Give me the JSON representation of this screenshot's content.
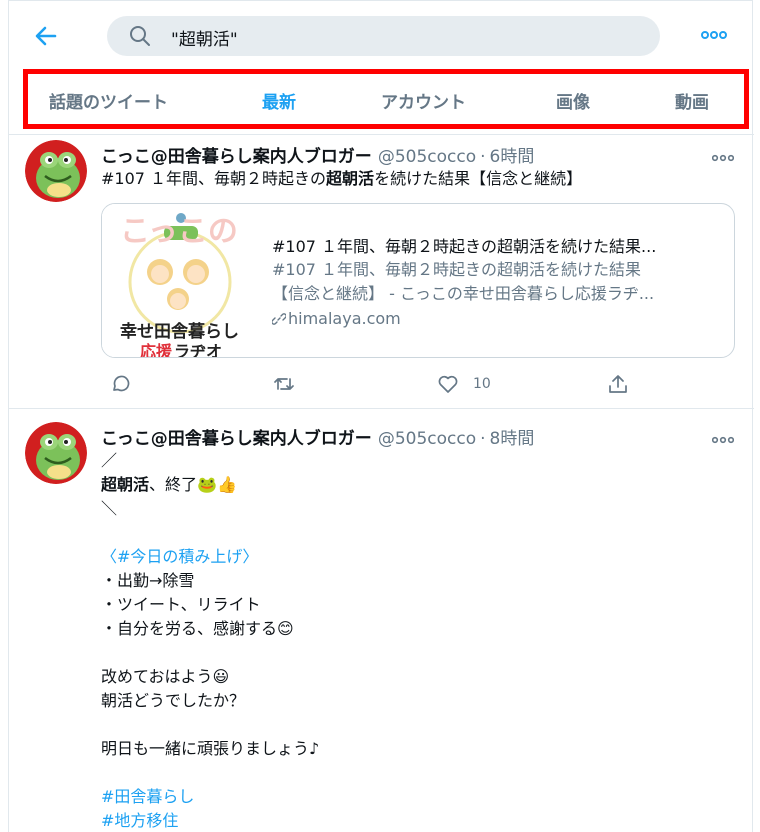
{
  "search": {
    "query": "\"超朝活\""
  },
  "tabs": [
    {
      "label": "話題のツイート",
      "active": false
    },
    {
      "label": "最新",
      "active": true
    },
    {
      "label": "アカウント",
      "active": false
    },
    {
      "label": "画像",
      "active": false
    },
    {
      "label": "動画",
      "active": false
    }
  ],
  "colors": {
    "accent": "#1da1f2",
    "highlight_border": "#ff0000",
    "muted": "#657786"
  },
  "tweets": [
    {
      "user_name": "こっこ@田舎暮らし案内人ブロガー",
      "handle": "@505cocco",
      "time": "6時間",
      "text_pre": "#107 １年間、毎朝２時起きの",
      "text_bold": "超朝活",
      "text_post": "を続けた結果【信念と継続】",
      "card": {
        "image_title_line1": "こっこの",
        "image_title_line2": "幸せ田舎暮らし",
        "image_title_line3a": "応援",
        "image_title_line3b": "ラヂオ",
        "title": "#107 １年間、毎朝２時起きの超朝活を続けた結果...",
        "desc_line1": "#107 １年間、毎朝２時起きの超朝活を続けた結果",
        "desc_line2": "【信念と継続】 - こっこの幸せ田舎暮らし応援ラヂ...",
        "domain": "himalaya.com"
      },
      "likes": "10"
    },
    {
      "user_name": "こっこ@田舎暮らし案内人ブロガー",
      "handle": "@505cocco",
      "time": "8時間",
      "line1": "／",
      "line2_bold": "超朝活",
      "line2_rest": "、終了🐸👍",
      "line3": "＼",
      "hashtag_line": "〈#今日の積み上げ〉",
      "bullet1": "・出勤→除雪",
      "bullet2": "・ツイート、リライト",
      "bullet3": "・自分を労る、感謝する😊",
      "line_greet1": "改めておはよう😃",
      "line_greet2": "朝活どうでしたか？",
      "line_tomorrow": "明日も一緒に頑張りましょう♪",
      "tag1": "#田舎暮らし",
      "tag2": "#地方移住"
    }
  ]
}
